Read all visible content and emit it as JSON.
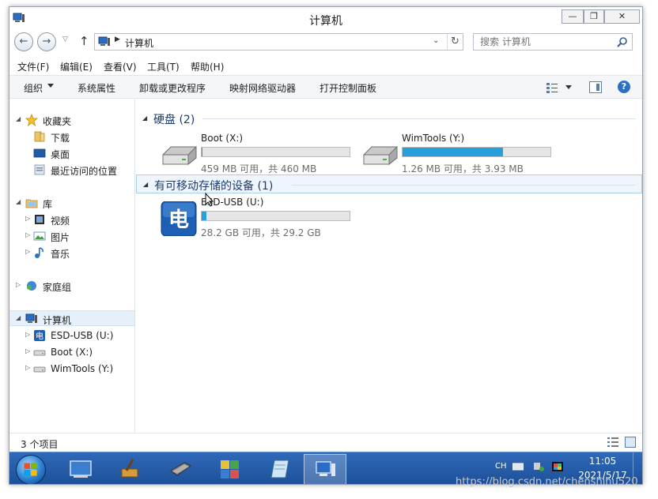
{
  "window": {
    "title": "计算机",
    "controls": {
      "minimize": "—",
      "maximize": "❐",
      "close": "✕"
    }
  },
  "address": {
    "path": "计算机",
    "search_placeholder": "搜索 计算机"
  },
  "menu": [
    "文件(F)",
    "编辑(E)",
    "查看(V)",
    "工具(T)",
    "帮助(H)"
  ],
  "commands": [
    "组织",
    "系统属性",
    "卸载或更改程序",
    "映射网络驱动器",
    "打开控制面板"
  ],
  "navigation": {
    "favorites": {
      "label": "收藏夹",
      "items": [
        "下载",
        "桌面",
        "最近访问的位置"
      ]
    },
    "libraries": {
      "label": "库",
      "items": [
        "视频",
        "图片",
        "音乐"
      ]
    },
    "homegroup": {
      "label": "家庭组"
    },
    "computer": {
      "label": "计算机",
      "items": [
        "ESD-USB (U:)",
        "Boot (X:)",
        "WimTools (Y:)"
      ]
    }
  },
  "groups": {
    "hard_disks": {
      "title": "硬盘 (2)",
      "drives": [
        {
          "name": "Boot (X:)",
          "free": "459 MB 可用，共 460 MB",
          "used_fraction": 0.002
        },
        {
          "name": "WimTools (Y:)",
          "free": "1.26 MB 可用，共 3.93 MB",
          "used_fraction": 0.68
        }
      ]
    },
    "removable": {
      "title": "有可移动存储的设备 (1)",
      "drives": [
        {
          "name": "ESD-USB (U:)",
          "free": "28.2 GB 可用，共 29.2 GB",
          "used_fraction": 0.034
        }
      ]
    }
  },
  "status": {
    "item_count": "3 个项目"
  },
  "taskbar": {
    "apps": [
      "screen-app",
      "cleanup-tool",
      "chip-tool",
      "puzzle-tool",
      "notepad",
      "computer-explorer"
    ],
    "tray_lang": "CH",
    "time": "11:05",
    "date": "2021/5/17"
  },
  "watermark": "https://blog.csdn.net/chenshihu520",
  "colors": {
    "accent": "#26a0da",
    "taskbar": "#2f69b8",
    "group_title": "#1e3b6e"
  }
}
